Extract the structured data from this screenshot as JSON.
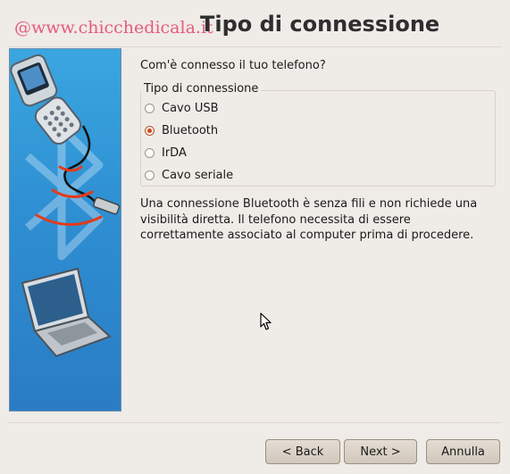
{
  "watermark": "@www.chicchedicala.it",
  "title": "Tipo di connessione",
  "question": "Com'è connesso il tuo telefono?",
  "connection_group": {
    "label": "Tipo di connessione",
    "options": [
      {
        "label": "Cavo USB",
        "checked": false
      },
      {
        "label": "Bluetooth",
        "checked": true
      },
      {
        "label": "IrDA",
        "checked": false
      },
      {
        "label": "Cavo seriale",
        "checked": false
      }
    ]
  },
  "description": "Una connessione Bluetooth è senza fili e non richiede una visibilità diretta. Il telefono necessita di essere correttamente associato al computer prima di procedere.",
  "buttons": {
    "back": "< Back",
    "next": "Next >",
    "cancel": "Annulla"
  },
  "colors": {
    "side_panel": "#2e8fd2",
    "selected_radio": "#d04a1c",
    "watermark": "#e65c7a"
  },
  "icons": [
    "flip-phone-icon",
    "usb-cable-icon",
    "bluetooth-logo-icon",
    "laptop-icon",
    "mouse-pointer-icon"
  ]
}
